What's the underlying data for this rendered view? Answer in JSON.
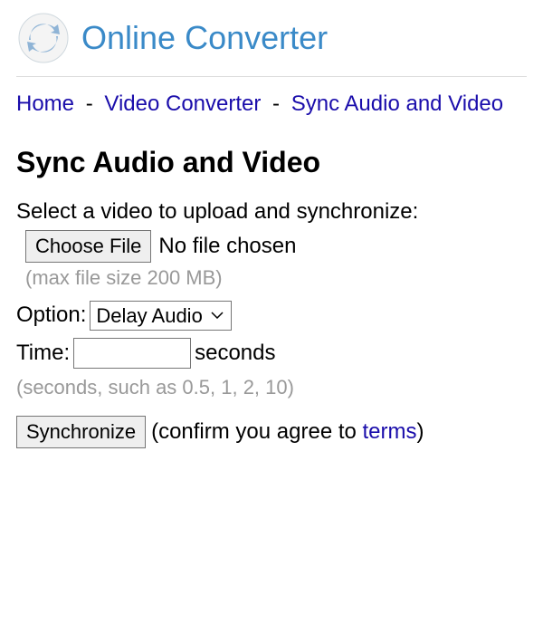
{
  "header": {
    "site_title": "Online Converter"
  },
  "breadcrumb": {
    "home": "Home",
    "video_converter": "Video Converter",
    "current": "Sync Audio and Video",
    "sep": "-"
  },
  "page": {
    "title": "Sync Audio and Video",
    "instruction": "Select a video to upload and synchronize:"
  },
  "file": {
    "choose_label": "Choose File",
    "status": "No file chosen",
    "hint": "(max file size 200 MB)"
  },
  "option": {
    "label": "Option:",
    "selected": "Delay Audio"
  },
  "time": {
    "label": "Time:",
    "value": "",
    "unit": "seconds",
    "hint": "(seconds, such as 0.5, 1, 2, 10)"
  },
  "submit": {
    "button": "Synchronize",
    "confirm_prefix": "(confirm you agree to ",
    "terms_link": "terms",
    "confirm_suffix": ")"
  }
}
